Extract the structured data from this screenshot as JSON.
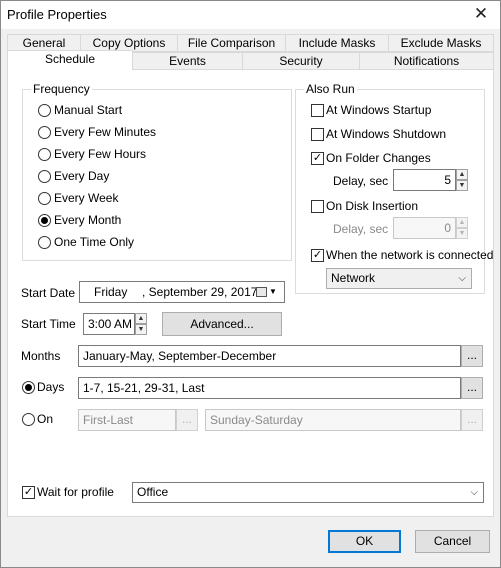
{
  "window": {
    "title": "Profile Properties",
    "close_glyph": "✕"
  },
  "tabs_back": [
    "General",
    "Copy Options",
    "File Comparison",
    "Include Masks",
    "Exclude Masks"
  ],
  "tabs_front": [
    "Schedule",
    "Events",
    "Security",
    "Notifications"
  ],
  "frequency": {
    "title": "Frequency",
    "options": [
      "Manual Start",
      "Every Few Minutes",
      "Every Few Hours",
      "Every Day",
      "Every Week",
      "Every Month",
      "One Time Only"
    ],
    "selected": "Every Month"
  },
  "also_run": {
    "title": "Also Run",
    "startup": {
      "label": "At Windows Startup",
      "checked": false
    },
    "shutdown": {
      "label": "At Windows Shutdown",
      "checked": false
    },
    "folder_changes": {
      "label": "On Folder Changes",
      "checked": true
    },
    "delay1": {
      "label": "Delay, sec",
      "value": "5"
    },
    "disk_insertion": {
      "label": "On Disk Insertion",
      "checked": false
    },
    "delay2": {
      "label": "Delay, sec",
      "value": "0"
    },
    "network": {
      "label": "When the network is connected",
      "checked": true
    },
    "network_select": "Network"
  },
  "start_date": {
    "label": "Start Date",
    "day": "Friday",
    "date": ", September 29, 2017"
  },
  "start_time": {
    "label": "Start Time",
    "value": "3:00 AM",
    "advanced": "Advanced..."
  },
  "months": {
    "label": "Months",
    "value": "January-May, September-December",
    "browse": "..."
  },
  "days": {
    "label": "Days",
    "value": "1-7, 15-21, 29-31, Last",
    "browse": "...",
    "selected": true
  },
  "on": {
    "label": "On",
    "first_last": "First-Last",
    "browse": "...",
    "weekday": "Sunday-Saturday"
  },
  "wait": {
    "label": "Wait for profile",
    "checked": true,
    "profile": "Office"
  },
  "buttons": {
    "ok": "OK",
    "cancel": "Cancel"
  },
  "glyphs": {
    "check": "✓",
    "up": "▲",
    "down": "▼",
    "combo_down": "⌵"
  },
  "icons": [
    "close-icon",
    "calendar-icon",
    "dropdown-arrow-icon",
    "spin-up-icon",
    "spin-down-icon"
  ]
}
